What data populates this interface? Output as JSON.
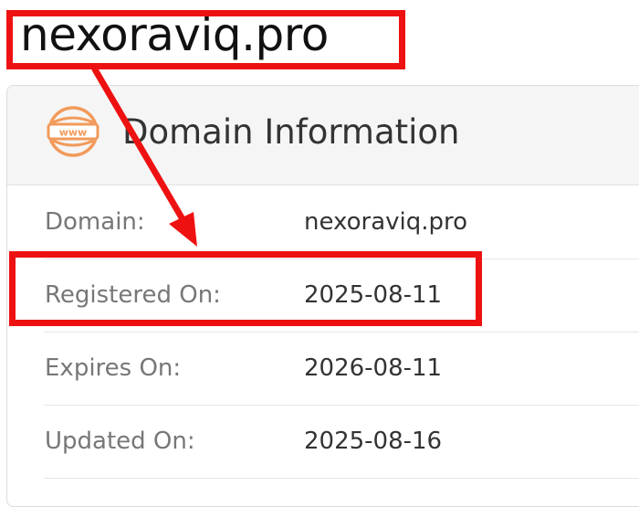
{
  "domain_heading": "nexoraviq.pro",
  "card": {
    "icon": "www-globe-icon",
    "title": "Domain Information",
    "rows": [
      {
        "label": "Domain:",
        "value": "nexoraviq.pro"
      },
      {
        "label": "Registered On:",
        "value": "2025-08-11"
      },
      {
        "label": "Expires On:",
        "value": "2026-08-11"
      },
      {
        "label": "Updated On:",
        "value": "2025-08-16"
      }
    ]
  },
  "colors": {
    "annotation": "#ee1111",
    "icon_orange": "#f29a5a",
    "header_bg": "#f5f5f5",
    "label_text": "#777777"
  }
}
